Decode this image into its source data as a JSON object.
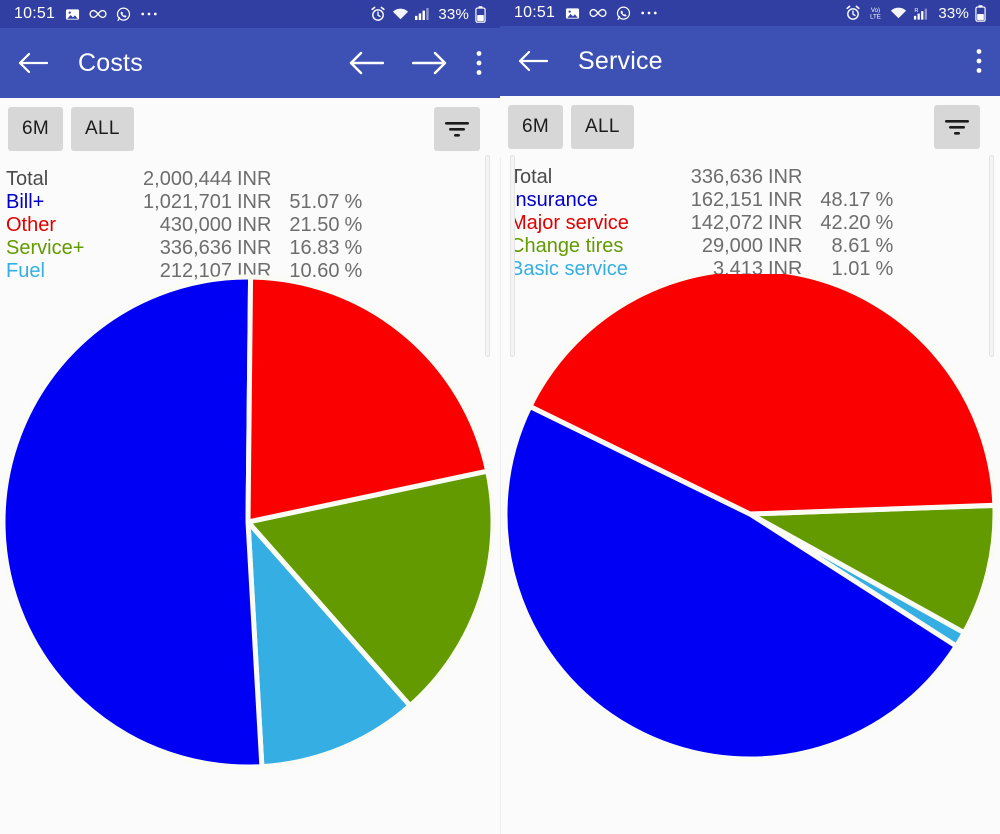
{
  "colors": {
    "statusbar": "#303FA1",
    "appbar": "#3D51B5",
    "chip_bg": "#d7d7d7",
    "page_bg": "#fbfbfb",
    "blue": "#0000F5",
    "red": "#FA0000",
    "green": "#639A00",
    "cyan": "#35AEE4",
    "label_gray": "#4a4a4a",
    "value_gray": "#6d6d6d"
  },
  "panels": [
    {
      "id": "costs",
      "statusbar": {
        "time": "10:51",
        "left_icons": [
          "image-icon",
          "infinity-icon",
          "whatsapp-icon",
          "more-dots-icon"
        ],
        "right_icons": [
          "alarm-icon",
          "wifi-icon",
          "signal-icon"
        ],
        "battery": "33%",
        "battery_icon": "battery-icon"
      },
      "appbar": {
        "back_icon": "arrow-back-icon",
        "title": "Costs",
        "actions": [
          "arrow-left-icon",
          "arrow-right-icon",
          "overflow-menu-icon"
        ]
      },
      "filterbar": {
        "chips": [
          {
            "label": "6M",
            "name": "range-6m-button"
          },
          {
            "label": "ALL",
            "name": "range-all-button"
          }
        ],
        "filter_icon": "filter-icon"
      },
      "legend": [
        {
          "label": "Total",
          "amount": "2,000,444",
          "unit": "INR",
          "percent": "",
          "pct_symbol": "",
          "color": "#4a4a4a"
        },
        {
          "label": "Bill+",
          "amount": "1,021,701",
          "unit": "INR",
          "percent": "51.07",
          "pct_symbol": "%",
          "color": "#0000C8"
        },
        {
          "label": "Other",
          "amount": "430,000",
          "unit": "INR",
          "percent": "21.50",
          "pct_symbol": "%",
          "color": "#E00000"
        },
        {
          "label": "Service+",
          "amount": "336,636",
          "unit": "INR",
          "percent": "16.83",
          "pct_symbol": "%",
          "color": "#639A00"
        },
        {
          "label": "Fuel",
          "amount": "212,107",
          "unit": "INR",
          "percent": "10.60",
          "pct_symbol": "%",
          "color": "#35AEE4"
        }
      ],
      "chart_data": {
        "type": "pie",
        "title": "Costs",
        "total": 2000444,
        "unit": "INR",
        "start_angle_deg": -12,
        "direction": "clockwise",
        "legend_position": "top-left",
        "categories": [
          "Bill+",
          "Other",
          "Service+",
          "Fuel"
        ],
        "values": [
          1021701,
          430000,
          336636,
          212107
        ],
        "percents": [
          51.07,
          21.5,
          16.83,
          10.6
        ],
        "colors": [
          "#0000F5",
          "#FA0000",
          "#639A00",
          "#35AEE4"
        ],
        "slice_order_clockwise": [
          "Service+",
          "Fuel",
          "Bill+",
          "Other"
        ]
      }
    },
    {
      "id": "service",
      "statusbar": {
        "time": "10:51",
        "left_icons": [
          "image-icon",
          "infinity-icon",
          "whatsapp-icon",
          "more-dots-icon"
        ],
        "right_icons": [
          "alarm-icon",
          "volte-icon",
          "wifi-icon",
          "signal-roaming-icon"
        ],
        "battery": "33%",
        "battery_icon": "battery-icon"
      },
      "appbar": {
        "back_icon": "arrow-back-icon",
        "title": "Service",
        "actions": [
          "overflow-menu-icon"
        ]
      },
      "filterbar": {
        "chips": [
          {
            "label": "6M",
            "name": "range-6m-button"
          },
          {
            "label": "ALL",
            "name": "range-all-button"
          }
        ],
        "filter_icon": "filter-icon"
      },
      "legend": [
        {
          "label": "Total",
          "amount": "336,636",
          "unit": "INR",
          "percent": "",
          "pct_symbol": "",
          "color": "#4a4a4a"
        },
        {
          "label": "Insurance",
          "amount": "162,151",
          "unit": "INR",
          "percent": "48.17",
          "pct_symbol": "%",
          "color": "#0000C8"
        },
        {
          "label": "Major service",
          "amount": "142,072",
          "unit": "INR",
          "percent": "42.20",
          "pct_symbol": "%",
          "color": "#E00000"
        },
        {
          "label": "Change tires",
          "amount": "29,000",
          "unit": "INR",
          "percent": "8.61",
          "pct_symbol": "%",
          "color": "#639A00"
        },
        {
          "label": "Basic service",
          "amount": "3,413",
          "unit": "INR",
          "percent": "1.01",
          "pct_symbol": "%",
          "color": "#35AEE4"
        }
      ],
      "chart_data": {
        "type": "pie",
        "title": "Service",
        "total": 336636,
        "unit": "INR",
        "start_angle_deg": -2,
        "direction": "clockwise",
        "legend_position": "top-left",
        "categories": [
          "Insurance",
          "Major service",
          "Change tires",
          "Basic service"
        ],
        "values": [
          162151,
          142072,
          29000,
          3413
        ],
        "percents": [
          48.17,
          42.2,
          8.61,
          1.01
        ],
        "colors": [
          "#0000F5",
          "#FA0000",
          "#639A00",
          "#35AEE4"
        ],
        "slice_order_clockwise": [
          "Change tires",
          "Basic service",
          "Insurance",
          "Major service"
        ]
      }
    }
  ]
}
